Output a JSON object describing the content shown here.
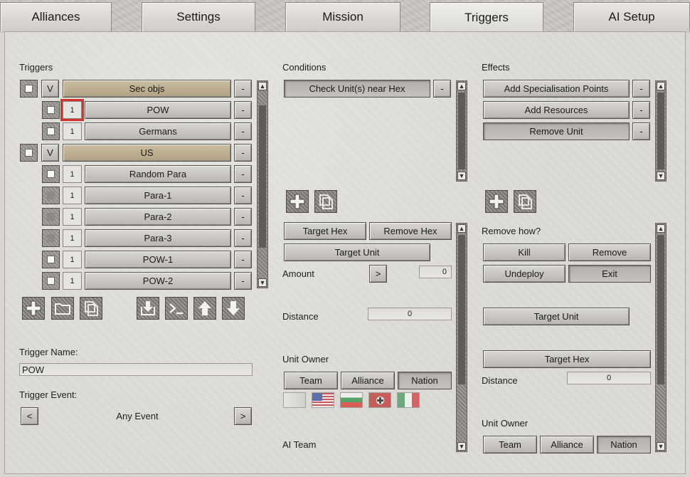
{
  "tabs": [
    "Alliances",
    "Settings",
    "Mission",
    "Triggers",
    "AI Setup"
  ],
  "active_tab": "Triggers",
  "triggers": {
    "heading": "Triggers",
    "rows": [
      {
        "type": "group",
        "label": "Sec objs",
        "v": "V",
        "remove": "-"
      },
      {
        "type": "item",
        "label": "POW",
        "count": "1",
        "remove": "-"
      },
      {
        "type": "item",
        "label": "Germans",
        "count": "1",
        "remove": "-"
      },
      {
        "type": "group",
        "label": "US",
        "v": "V",
        "remove": "-"
      },
      {
        "type": "item",
        "label": "Random Para",
        "count": "1",
        "remove": "-"
      },
      {
        "type": "item",
        "label": "Para-1",
        "count": "1",
        "remove": "-"
      },
      {
        "type": "item",
        "label": "Para-2",
        "count": "1",
        "remove": "-"
      },
      {
        "type": "item",
        "label": "Para-3",
        "count": "1",
        "remove": "-"
      },
      {
        "type": "item",
        "label": "POW-1",
        "count": "1",
        "remove": "-"
      },
      {
        "type": "item",
        "label": "POW-2",
        "count": "1",
        "remove": "-"
      }
    ],
    "toolbar_icons": [
      "plus-icon",
      "folder-icon",
      "copy-icon",
      "import-icon",
      "console-icon",
      "arrow-up-icon",
      "arrow-down-icon"
    ],
    "name_label": "Trigger Name:",
    "name_value": "POW",
    "event_label": "Trigger Event:",
    "event_value": "Any Event",
    "event_prev": "<",
    "event_next": ">"
  },
  "conditions": {
    "heading": "Conditions",
    "items": [
      {
        "label": "Check Unit(s) near Hex",
        "remove": "-"
      }
    ],
    "target_hex": "Target Hex",
    "remove_hex": "Remove Hex",
    "target_unit": "Target Unit",
    "amount_label": "Amount",
    "amount_arrow": ">",
    "amount_value": "0",
    "distance_label": "Distance",
    "distance_value": "0",
    "unit_owner_label": "Unit Owner",
    "owner_options": [
      "Team",
      "Alliance",
      "Nation"
    ],
    "owner_selected": "Nation",
    "flags": [
      "flag-neutral-icon",
      "flag-usa-icon",
      "flag-bulgaria-icon",
      "flag-germany-icon",
      "flag-italy-icon"
    ],
    "ai_team_label": "AI Team"
  },
  "effects": {
    "heading": "Effects",
    "items": [
      {
        "label": "Add Specialisation Points",
        "remove": "-"
      },
      {
        "label": "Add Resources",
        "remove": "-"
      },
      {
        "label": "Remove Unit",
        "remove": "-"
      }
    ],
    "remove_how_label": "Remove how?",
    "remove_options": [
      "Kill",
      "Remove",
      "Undeploy",
      "Exit"
    ],
    "remove_selected": "Exit",
    "target_unit": "Target Unit",
    "target_hex": "Target Hex",
    "distance_label": "Distance",
    "distance_value": "0",
    "unit_owner_label": "Unit Owner",
    "owner_options": [
      "Team",
      "Alliance",
      "Nation"
    ],
    "owner_selected": "Nation"
  },
  "colors": {
    "highlight": "#d8312c",
    "group_row": "#b7a989",
    "panel": "#dcdad6"
  }
}
